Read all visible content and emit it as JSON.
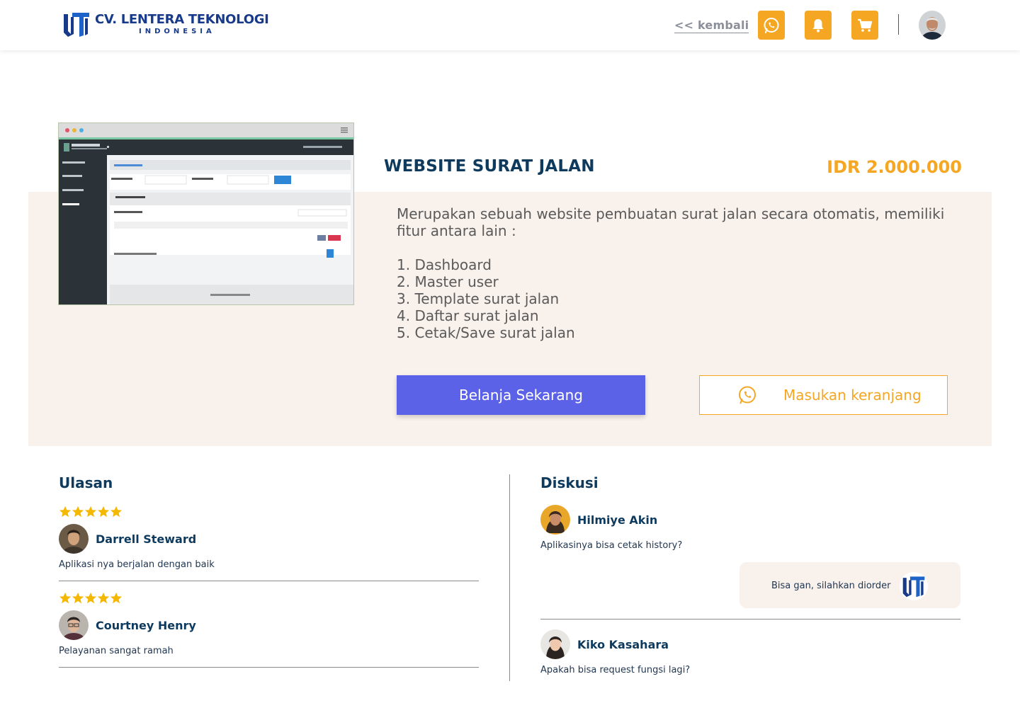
{
  "header": {
    "brand_name": "CV. LENTERA TEKNOLOGI",
    "brand_sub": "INDONESIA",
    "back_label": "<< kembali",
    "icons": [
      "whatsapp-icon",
      "bell-icon",
      "cart-icon"
    ],
    "accent": "#f5a623"
  },
  "product": {
    "title": "WEBSITE SURAT JALAN",
    "price": "IDR 2.000.000",
    "description": "Merupakan sebuah website pembuatan surat jalan secara otomatis, memiliki fitur antara lain :",
    "features": [
      "1. Dashboard",
      "2. Master user",
      "3. Template surat jalan",
      "4. Daftar surat jalan",
      "5. Cetak/Save surat jalan"
    ],
    "buy_label": "Belanja Sekarang",
    "cart_label": "Masukan keranjang",
    "buy_color": "#5b62e8",
    "bg_color": "#f9f1ec"
  },
  "reviews": {
    "title": "Ulasan",
    "items": [
      {
        "rating": 5,
        "name": "Darrell Steward",
        "comment": "Aplikasi nya berjalan dengan baik"
      },
      {
        "rating": 5,
        "name": "Courtney Henry",
        "comment": "Pelayanan sangat ramah"
      }
    ]
  },
  "discussion": {
    "title": "Diskusi",
    "items": [
      {
        "name": "Hilmiye Akin",
        "question": "Aplikasinya bisa cetak history?",
        "reply": "Bisa gan, silahkan diorder"
      },
      {
        "name": "Kiko Kasahara",
        "question": "Apakah bisa request fungsi lagi?"
      }
    ]
  }
}
